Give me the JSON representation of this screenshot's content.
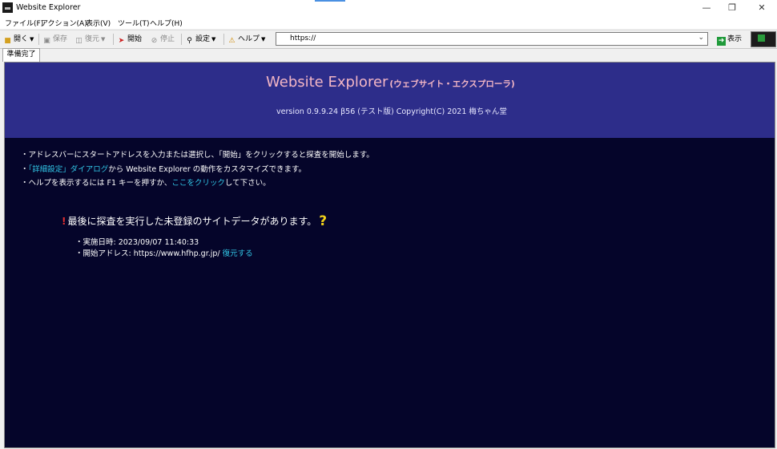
{
  "window": {
    "title": "Website Explorer"
  },
  "menu": [
    "ファイル(F)",
    "アクション(A)",
    "表示(V)",
    "ツール(T)",
    "ヘルプ(H)"
  ],
  "toolbar": {
    "open": "開く",
    "save": "保存",
    "restore": "復元",
    "start": "開始",
    "stop": "停止",
    "settings": "設定",
    "help": "ヘルプ",
    "view": "表示"
  },
  "address": {
    "value": "https://"
  },
  "tab": {
    "label": "準備完了"
  },
  "banner": {
    "title": "Website Explorer",
    "subtitle": "(ウェブサイト・エクスプローラ)",
    "version": "version 0.9.9.24 β56 (テスト版) Copyright(C) 2021 梅ちゃん堂"
  },
  "bullets": {
    "b1": "・アドレスバーにスタートアドレスを入力または選択し、「開始」をクリックすると探査を開始します。",
    "b2_prefix": "・",
    "b2_link": "「詳細設定」ダイアログ",
    "b2_suffix": "から Website Explorer の動作をカスタマイズできます。",
    "b3_prefix": "・ヘルプを表示するには F1 キーを押すか、",
    "b3_link": "ここをクリック",
    "b3_suffix": "して下さい。"
  },
  "notice": {
    "bang": "!",
    "message": "最後に探査を実行した未登録のサイトデータがあります。",
    "q": "?",
    "date_line": "・実施日時: 2023/09/07 11:40:33",
    "addr_line": "・開始アドレス: https://www.hfhp.gr.jp/",
    "restore_link": "復元する"
  }
}
